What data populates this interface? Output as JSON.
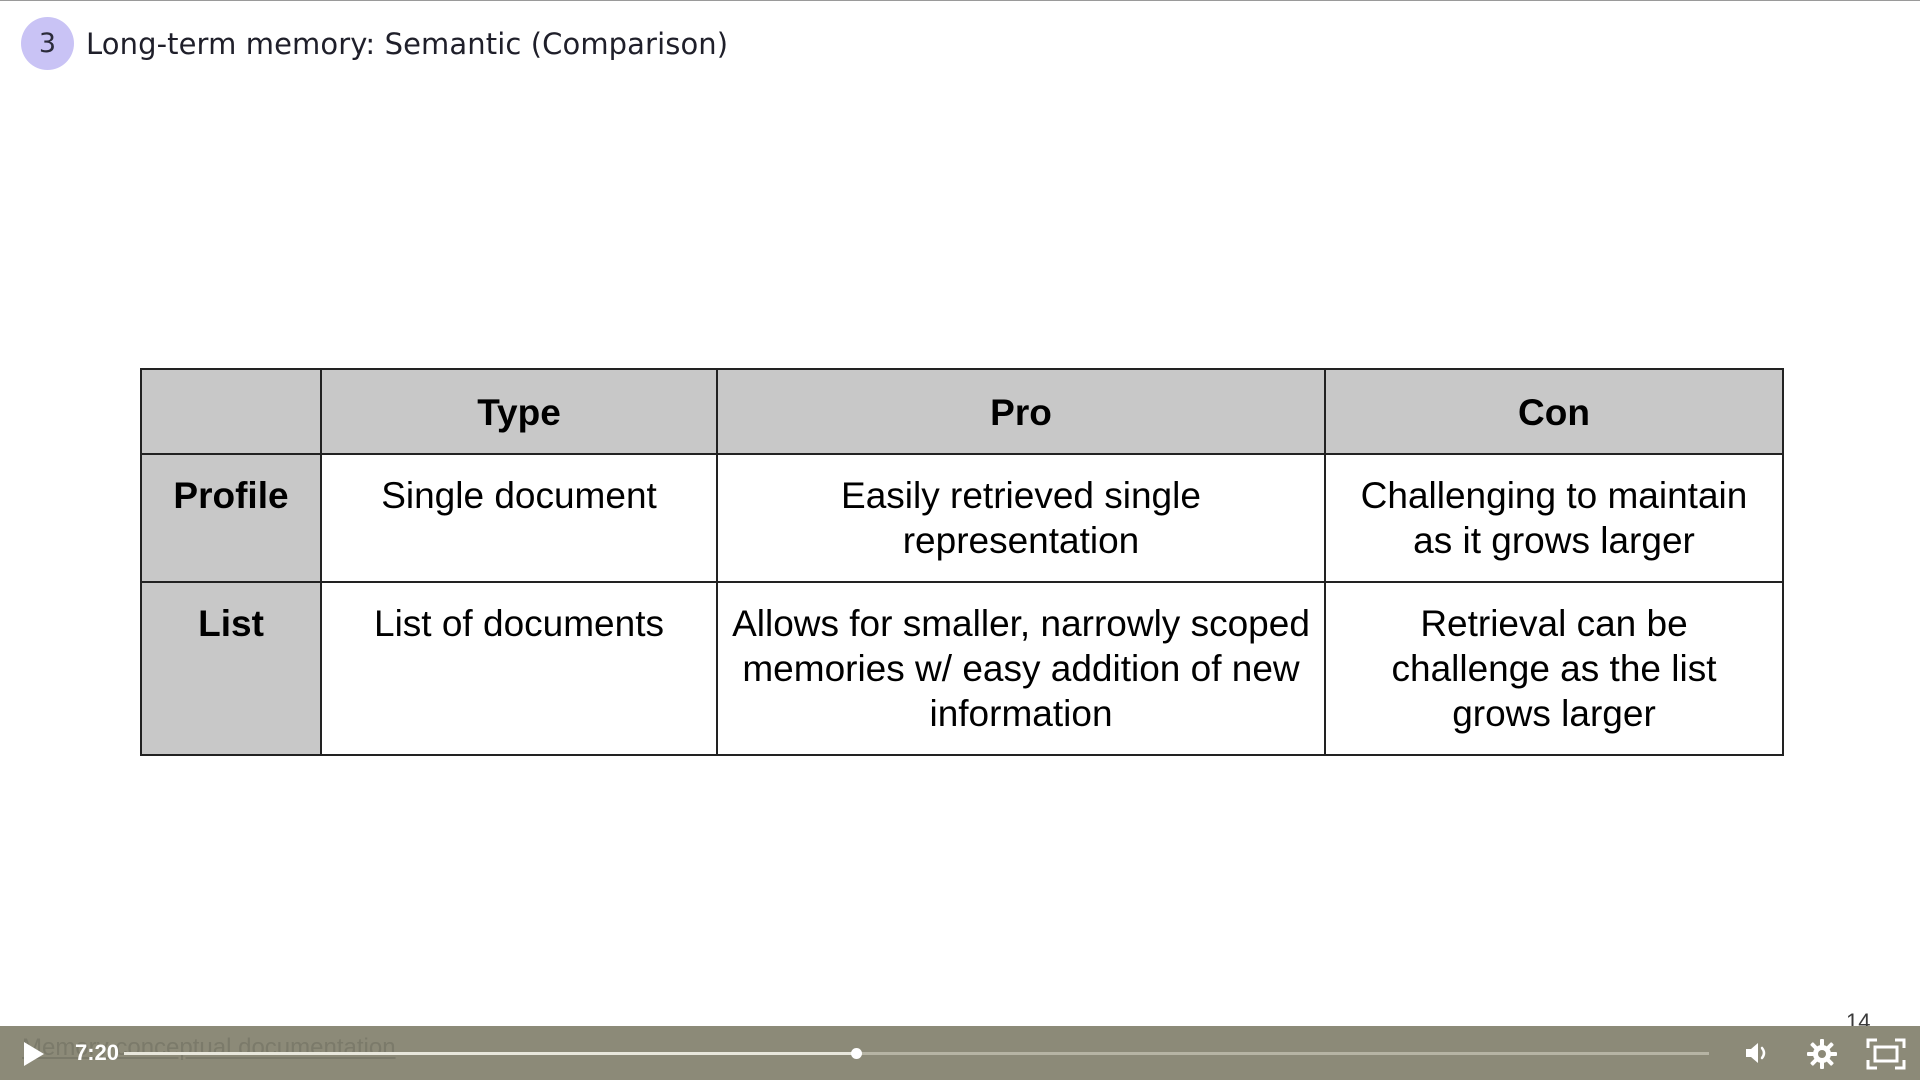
{
  "header": {
    "step_number": "3",
    "title": "Long-term memory: Semantic (Comparison)"
  },
  "table": {
    "columns": [
      "",
      "Type",
      "Pro",
      "Con"
    ],
    "rows": [
      {
        "label": "Profile",
        "type": "Single document",
        "pro": "Easily retrieved single representation",
        "con": "Challenging to maintain as it grows larger"
      },
      {
        "label": "List",
        "type": "List of documents",
        "pro": "Allows for smaller, narrowly scoped memories w/ easy addition of new information",
        "con": "Retrieval can be challenge as the list grows larger"
      }
    ]
  },
  "footer": {
    "link_text": "Memory conceptual documentation",
    "page_number": "14"
  },
  "player": {
    "time": "7:20",
    "progress_fraction": 0.462,
    "icons": {
      "play": "play-icon",
      "volume": "volume-icon",
      "settings": "gear-icon",
      "fullscreen": "fullscreen-icon"
    }
  }
}
